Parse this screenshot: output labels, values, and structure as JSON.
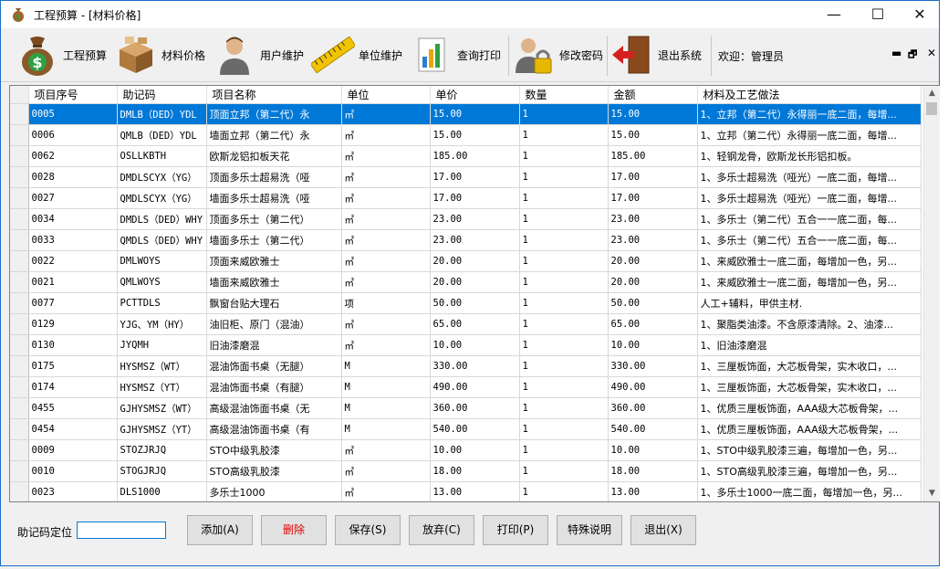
{
  "window": {
    "title": "工程预算 - [材料价格]",
    "min_glyph": "—",
    "max_glyph": "☐",
    "close_glyph": "✕"
  },
  "toolbar": {
    "items": [
      {
        "label": "工程预算",
        "icon": "money-bag-icon"
      },
      {
        "label": "材料价格",
        "icon": "boxes-icon"
      },
      {
        "label": "用户维护",
        "icon": "user-icon"
      },
      {
        "label": "单位维护",
        "icon": "ruler-icon"
      },
      {
        "label": "查询打印",
        "icon": "chart-print-icon"
      },
      {
        "label": "修改密码",
        "icon": "user-lock-icon"
      },
      {
        "label": "退出系统",
        "icon": "exit-door-icon"
      }
    ],
    "welcome": "欢迎：管理员",
    "mdi_min": "▬",
    "mdi_restore": "🗗",
    "mdi_close": "✕"
  },
  "grid": {
    "columns": [
      "项目序号",
      "助记码",
      "项目名称",
      "单位",
      "单价",
      "数量",
      "金额",
      "材料及工艺做法"
    ],
    "rows": [
      [
        "0005",
        "DMLB（DED）YDL",
        "顶面立邦（第二代）永",
        "㎡",
        "15.00",
        "1",
        "15.00",
        "1、立邦（第二代）永得丽一底二面，每增..."
      ],
      [
        "0006",
        "QMLB（DED）YDL",
        "墙面立邦（第二代）永",
        "㎡",
        "15.00",
        "1",
        "15.00",
        "1、立邦（第二代）永得丽一底二面，每增..."
      ],
      [
        "0062",
        "OSLLKBTH",
        "欧斯龙铝扣板天花",
        "㎡",
        "185.00",
        "1",
        "185.00",
        "1、轻钢龙骨，欧斯龙长形铝扣板。"
      ],
      [
        "0028",
        "DMDLSCYX（YG）",
        "顶面多乐士超易洗（哑",
        "㎡",
        "17.00",
        "1",
        "17.00",
        "1、多乐士超易洗（哑光）一底二面，每增..."
      ],
      [
        "0027",
        "QMDLSCYX（YG）",
        "墙面多乐士超易洗（哑",
        "㎡",
        "17.00",
        "1",
        "17.00",
        "1、多乐士超易洗（哑光）一底二面，每增..."
      ],
      [
        "0034",
        "DMDLS（DED）WHY",
        "顶面多乐士（第二代）",
        "㎡",
        "23.00",
        "1",
        "23.00",
        "1、多乐士（第二代）五合一一底二面，每..."
      ],
      [
        "0033",
        "QMDLS（DED）WHY",
        "墙面多乐士（第二代）",
        "㎡",
        "23.00",
        "1",
        "23.00",
        "1、多乐士（第二代）五合一一底二面，每..."
      ],
      [
        "0022",
        "DMLWOYS",
        "顶面来威欧雅士",
        "㎡",
        "20.00",
        "1",
        "20.00",
        "1、来威欧雅士一底二面，每增加一色，另..."
      ],
      [
        "0021",
        "QMLWOYS",
        "墙面来威欧雅士",
        "㎡",
        "20.00",
        "1",
        "20.00",
        "1、来威欧雅士一底二面，每增加一色，另..."
      ],
      [
        "0077",
        "PCTTDLS",
        "飘窗台贴大理石",
        "项",
        "50.00",
        "1",
        "50.00",
        "人工+辅料，甲供主材."
      ],
      [
        "0129",
        "YJG、YM（HY）",
        "油旧柜、原门（混油）",
        "㎡",
        "65.00",
        "1",
        "65.00",
        "1、聚脂类油漆。不含原漆清除。2、油漆..."
      ],
      [
        "0130",
        "JYQMH",
        "旧油漆磨混",
        "㎡",
        "10.00",
        "1",
        "10.00",
        "1、旧油漆磨混"
      ],
      [
        "0175",
        "HYSMSZ（WT）",
        "混油饰面书桌（无腿）",
        "M",
        "330.00",
        "1",
        "330.00",
        "1、三厘板饰面，大芯板骨架，实木收口，..."
      ],
      [
        "0174",
        "HYSMSZ（YT）",
        "混油饰面书桌（有腿）",
        "M",
        "490.00",
        "1",
        "490.00",
        "1、三厘板饰面，大芯板骨架，实木收口，..."
      ],
      [
        "0455",
        "GJHYSMSZ（WT）",
        "高级混油饰面书桌（无",
        "M",
        "360.00",
        "1",
        "360.00",
        "1、优质三厘板饰面，AAA级大芯板骨架，..."
      ],
      [
        "0454",
        "GJHYSMSZ（YT）",
        "高级混油饰面书桌（有",
        "M",
        "540.00",
        "1",
        "540.00",
        "1、优质三厘板饰面，AAA级大芯板骨架，..."
      ],
      [
        "0009",
        "STOZJRJQ",
        "STO中级乳胶漆",
        "㎡",
        "10.00",
        "1",
        "10.00",
        "1、STO中级乳胶漆三遍，每增加一色，另..."
      ],
      [
        "0010",
        "STOGJRJQ",
        "STO高级乳胶漆",
        "㎡",
        "18.00",
        "1",
        "18.00",
        "1、STO高级乳胶漆三遍，每增加一色，另..."
      ],
      [
        "0023",
        "DLS1000",
        "多乐士1000",
        "㎡",
        "13.00",
        "1",
        "13.00",
        "1、多乐士1000一底二面，每增加一色，另..."
      ]
    ],
    "selected_row": 0
  },
  "bottom": {
    "locate_label": "助记码定位",
    "locate_value": "",
    "buttons": [
      {
        "label": "添加(A)",
        "color": "#000000"
      },
      {
        "label": "删除",
        "color": "#e00000"
      },
      {
        "label": "保存(S)",
        "color": "#000000"
      },
      {
        "label": "放弃(C)",
        "color": "#000000"
      },
      {
        "label": "打印(P)",
        "color": "#000000"
      },
      {
        "label": "特殊说明",
        "color": "#000000"
      },
      {
        "label": "退出(X)",
        "color": "#000000"
      }
    ]
  },
  "colors": {
    "selection": "#0078d7",
    "accent_border": "#1b6fc7"
  }
}
